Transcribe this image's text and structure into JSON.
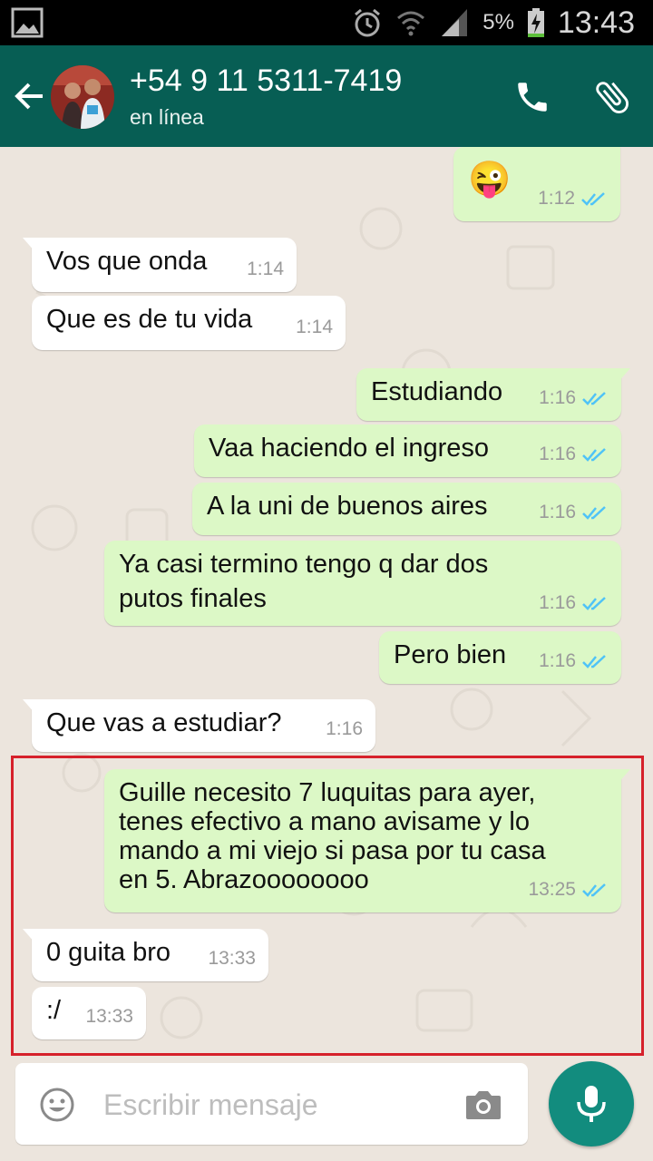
{
  "status_bar": {
    "battery_percent": "5%",
    "time": "13:43"
  },
  "header": {
    "contact_name": "+54 9 11 5311-7419",
    "status": "en línea"
  },
  "messages": [
    {
      "dir": "out",
      "text": "😜",
      "time": "1:12"
    },
    {
      "dir": "in",
      "text": "Vos que onda",
      "time": "1:14"
    },
    {
      "dir": "in",
      "text": "Que es de tu vida",
      "time": "1:14"
    },
    {
      "dir": "out",
      "text": "Estudiando",
      "time": "1:16"
    },
    {
      "dir": "out",
      "text": "Vaa haciendo el ingreso",
      "time": "1:16"
    },
    {
      "dir": "out",
      "text": "A la uni de buenos aires",
      "time": "1:16"
    },
    {
      "dir": "out",
      "text": [
        "Ya casi termino tengo q dar dos",
        "putos finales"
      ],
      "time": "1:16"
    },
    {
      "dir": "out",
      "text": "Pero bien",
      "time": "1:16"
    },
    {
      "dir": "in",
      "text": "Que vas a estudiar?",
      "time": "1:16"
    },
    {
      "dir": "out",
      "text": [
        "Guille necesito 7 luquitas para ayer,",
        "tenes efectivo a mano avisame y lo",
        "mando a mi viejo si pasa por tu casa",
        "en 5. Abrazoooooooo"
      ],
      "time": "13:25"
    },
    {
      "dir": "in",
      "text": "0 guita bro",
      "time": "13:33"
    },
    {
      "dir": "in",
      "text": ":/",
      "time": "13:33"
    }
  ],
  "composer": {
    "placeholder": "Escribir mensaje"
  },
  "colors": {
    "header": "#075e54",
    "outgoing_bubble": "#dcf8c6",
    "incoming_bubble": "#ffffff",
    "mic_button": "#128c7e",
    "read_ticks": "#4fc3f7",
    "highlight_border": "#d6212b"
  }
}
